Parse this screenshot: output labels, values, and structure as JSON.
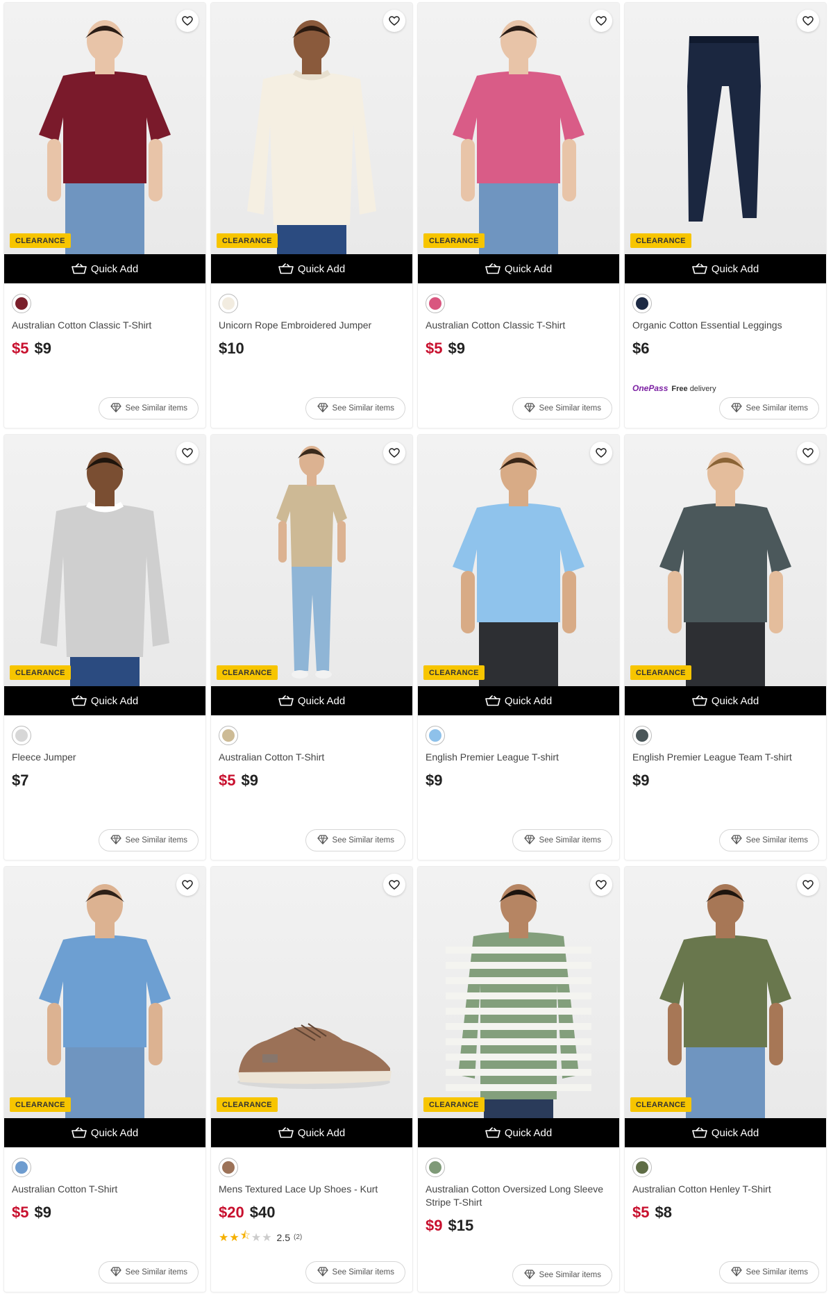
{
  "products": [
    {
      "title": "Australian Cotton Classic T-Shirt",
      "sale_price": "$5",
      "price": "$9",
      "swatch_color": "#7a1f2b",
      "garment": "tee-woman",
      "color": "#7a1a2b",
      "skin": "#e8c4a8",
      "hair": "#2a1d16"
    },
    {
      "title": "Unicorn Rope Embroidered Jumper",
      "sale_price": "",
      "price": "$10",
      "swatch_color": "#f2ece0",
      "garment": "jumper-kid",
      "color": "#f5efe2",
      "skin": "#8a5a3c",
      "hair": "#2a1a10"
    },
    {
      "title": "Australian Cotton Classic T-Shirt",
      "sale_price": "$5",
      "price": "$9",
      "swatch_color": "#d9567f",
      "garment": "tee-woman",
      "color": "#d95c87",
      "skin": "#e8c4a8",
      "hair": "#2a1d16"
    },
    {
      "title": "Organic Cotton Essential Leggings",
      "sale_price": "",
      "price": "$6",
      "swatch_color": "#1d2a44",
      "garment": "leggings",
      "color": "#1b2740",
      "onepass_brand": "OnePass",
      "onepass_free": "Free",
      "onepass_text": "delivery"
    },
    {
      "title": "Fleece Jumper",
      "sale_price": "",
      "price": "$7",
      "swatch_color": "#d7d7d7",
      "garment": "jumper-kid",
      "color": "#cfcfcf",
      "skin": "#7a4e32",
      "hair": "#1e140c"
    },
    {
      "title": "Australian Cotton T-Shirt",
      "sale_price": "$5",
      "price": "$9",
      "swatch_color": "#cdbb95",
      "garment": "tee-man-full",
      "color": "#cdb995",
      "skin": "#dcb291",
      "hair": "#3a2a1c"
    },
    {
      "title": "English Premier League T-shirt",
      "sale_price": "",
      "price": "$9",
      "swatch_color": "#8ec1ea",
      "garment": "tee-kid",
      "color": "#8fc3ec",
      "skin": "#d8ab86",
      "hair": "#3a2617"
    },
    {
      "title": "English Premier League Team T-shirt",
      "sale_price": "",
      "price": "$9",
      "swatch_color": "#4a5659",
      "garment": "tee-kid",
      "color": "#4b585b",
      "skin": "#e4bd9c",
      "hair": "#8a6335"
    },
    {
      "title": "Australian Cotton T-Shirt",
      "sale_price": "$5",
      "price": "$9",
      "swatch_color": "#6e9ccf",
      "garment": "tee-man",
      "color": "#6d9fd2",
      "skin": "#dcb291",
      "hair": "#2d2018"
    },
    {
      "title": "Mens Textured Lace Up Shoes - Kurt",
      "sale_price": "$20",
      "price": "$40",
      "swatch_color": "#9c7258",
      "garment": "shoe",
      "color": "#9b7157",
      "rating_score": "2.5",
      "rating_count": "(2)",
      "rating_value": 2.5
    },
    {
      "title": "Australian Cotton Oversized Long Sleeve Stripe T-Shirt",
      "sale_price": "$9",
      "price": "$15",
      "swatch_color": "#7f9a78",
      "garment": "stripe",
      "color": "#839f7c",
      "skin": "#b68563",
      "hair": "#1d140e"
    },
    {
      "title": "Australian Cotton Henley T-Shirt",
      "sale_price": "$5",
      "price": "$8",
      "swatch_color": "#5f6d46",
      "garment": "tee-man",
      "color": "#69774d",
      "skin": "#a77756",
      "hair": "#1e150e"
    }
  ],
  "labels": {
    "badge": "CLEARANCE",
    "quick_add": "Quick Add",
    "see_similar": "See Similar items"
  }
}
